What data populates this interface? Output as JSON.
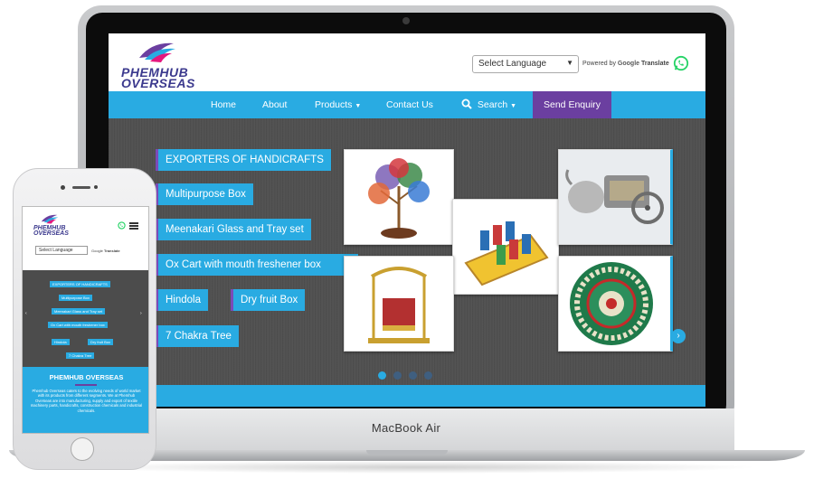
{
  "site": {
    "brand_line1": "PHEMHUB",
    "brand_line2": "OVERSEAS",
    "language_select": "Select Language",
    "powered_by": "Powered by",
    "google": "Google",
    "translate": "Translate"
  },
  "nav": {
    "home": "Home",
    "about": "About",
    "products": "Products",
    "contact": "Contact Us",
    "search": "Search",
    "enquiry": "Send Enquiry"
  },
  "hero": {
    "tags": [
      "EXPORTERS OF HANDICRAFTS",
      "Multipurpose Box",
      "Meenakari Glass and Tray set",
      "Ox Cart with mouth freshener box",
      "Hindola",
      "Dry fruit Box",
      "7 Chakra Tree"
    ],
    "next_arrow": "›",
    "prev_arrow": "‹"
  },
  "laptop": {
    "label": "MacBook Air"
  },
  "mobile": {
    "section_title": "PHEMHUB OVERSEAS",
    "description": "Phemhub Overseas caters to the evolving needs of world market with its products from different segments. We at Phemhub Overseas are into manufacturing, supply and export of textile machinery parts, handicrafts, construction chemicals and industrial chemicals."
  },
  "colors": {
    "brand_blue": "#29abe2",
    "brand_purple": "#6b3fa0",
    "logo_navy": "#3c3a8e",
    "whatsapp_green": "#25d366"
  }
}
